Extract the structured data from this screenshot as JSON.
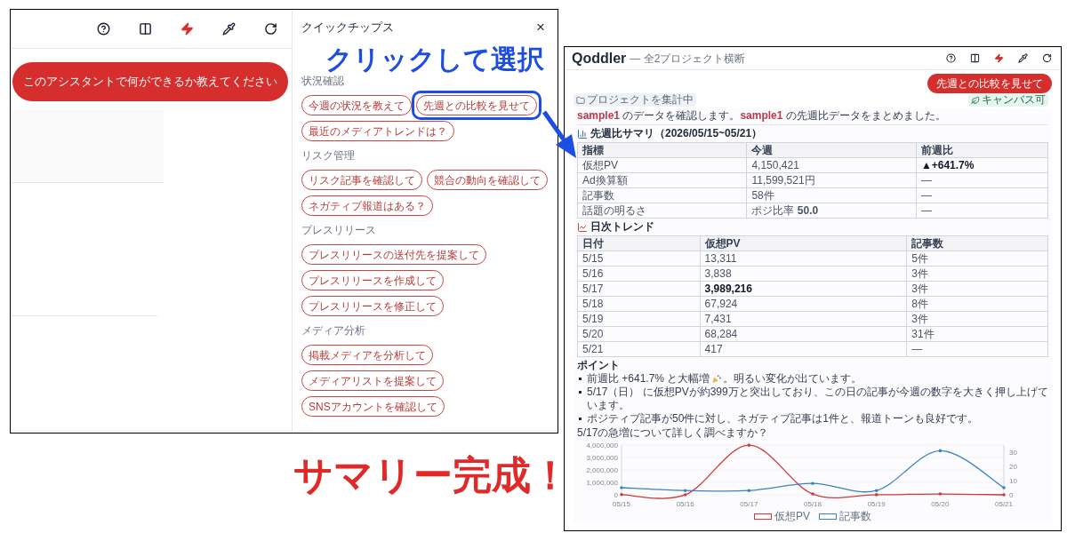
{
  "left_window": {
    "user_message": "このアシスタントで何ができるか教えてください",
    "quick_tips": {
      "title": "クイックチップス",
      "close": "×",
      "sections": [
        {
          "heading": "状況確認",
          "chips": [
            {
              "label": "今週の状況を教えて",
              "highlighted": false
            },
            {
              "label": "先週との比較を見せて",
              "highlighted": true
            },
            {
              "label": "最近のメディアトレンドは？",
              "highlighted": false
            }
          ]
        },
        {
          "heading": "リスク管理",
          "chips": [
            {
              "label": "リスク記事を確認して",
              "highlighted": false
            },
            {
              "label": "競合の動向を確認して",
              "highlighted": false
            },
            {
              "label": "ネガティブ報道はある？",
              "highlighted": false
            }
          ]
        },
        {
          "heading": "プレスリリース",
          "chips": [
            {
              "label": "プレスリリースの送付先を提案して",
              "highlighted": false
            },
            {
              "label": "プレスリリースを作成して",
              "highlighted": false
            },
            {
              "label": "プレスリリースを修正して",
              "highlighted": false
            }
          ]
        },
        {
          "heading": "メディア分析",
          "chips": [
            {
              "label": "掲載メディアを分析して",
              "highlighted": false
            },
            {
              "label": "メディアリストを提案して",
              "highlighted": false
            },
            {
              "label": "SNSアカウントを確認して",
              "highlighted": false
            }
          ]
        }
      ]
    }
  },
  "right_window": {
    "logo": "Qoddler",
    "subtitle": "— 全2プロジェクト横断",
    "user_message": "先週との比較を見せて",
    "status_tag": "プロジェクトを集計中",
    "canvas_badge": "キャンバス可",
    "reply": [
      {
        "kind": "project",
        "text": "sample1"
      },
      {
        "kind": "plain",
        "text": " のデータを確認します。"
      },
      {
        "kind": "project",
        "text": "sample1"
      },
      {
        "kind": "plain",
        "text": " の先週比データをまとめました。"
      }
    ],
    "summary": {
      "title": "先週比サマリ（2026/05/15~05/21）",
      "columns": [
        "指標",
        "今週",
        "前週比"
      ],
      "rows": [
        {
          "cells": [
            "仮想PV",
            "4,150,421",
            "▲+641.7%"
          ],
          "bold": [
            false,
            false,
            true
          ]
        },
        {
          "cells": [
            "Ad換算額",
            "11,599,521円",
            "—"
          ],
          "bold": [
            false,
            false,
            false
          ]
        },
        {
          "cells": [
            "記事数",
            "58件",
            "—"
          ],
          "bold": [
            false,
            false,
            false
          ]
        },
        {
          "cells": [
            "話題の明るさ",
            "ポジ比率 **50.0**",
            "—"
          ],
          "bold": [
            false,
            false,
            false
          ]
        }
      ]
    },
    "trend": {
      "title": "日次トレンド",
      "columns": [
        "日付",
        "仮想PV",
        "記事数"
      ],
      "rows": [
        {
          "cells": [
            "5/15",
            "13,311",
            "5件"
          ],
          "bold": [
            false,
            false,
            false
          ]
        },
        {
          "cells": [
            "5/16",
            "3,838",
            "3件"
          ],
          "bold": [
            false,
            false,
            false
          ]
        },
        {
          "cells": [
            "5/17",
            "3,989,216",
            "3件"
          ],
          "bold": [
            false,
            true,
            false
          ]
        },
        {
          "cells": [
            "5/18",
            "67,924",
            "8件"
          ],
          "bold": [
            false,
            false,
            false
          ]
        },
        {
          "cells": [
            "5/19",
            "7,431",
            "3件"
          ],
          "bold": [
            false,
            false,
            false
          ]
        },
        {
          "cells": [
            "5/20",
            "68,284",
            "31件"
          ],
          "bold": [
            false,
            false,
            false
          ]
        },
        {
          "cells": [
            "5/21",
            "417",
            "—"
          ],
          "bold": [
            false,
            false,
            false
          ]
        }
      ]
    },
    "points": {
      "title": "ポイント",
      "items": [
        {
          "before": "前週比 +641.7% と大幅増",
          "after": "。明るい変化が出ています。"
        },
        {
          "before": "5/17（日） に仮想PVが約399万と突出しており、この日の記事が今週の数字を大きく押し上げています。"
        },
        {
          "before": "ポジティブ記事が50件に対し、ネガティブ記事は1件と、報道トーンも良好です。"
        }
      ]
    },
    "question": "5/17の急増について詳しく調べますか？",
    "chart_data": {
      "type": "line",
      "x": [
        "05/15",
        "05/16",
        "05/17",
        "05/18",
        "05/19",
        "05/20",
        "05/21"
      ],
      "series": [
        {
          "name": "仮想PV",
          "color": "#d03a3a",
          "values": [
            13311,
            3838,
            3989216,
            67924,
            7431,
            68284,
            417
          ]
        },
        {
          "name": "記事数",
          "color": "#3b82c4",
          "axis": "y2",
          "values": [
            5,
            3,
            3,
            8,
            3,
            31,
            5
          ]
        }
      ],
      "ylim": [
        0,
        4000000
      ],
      "yticks": [
        {
          "value": 0,
          "label": "0"
        },
        {
          "value": 1000000,
          "label": "1,000,000"
        },
        {
          "value": 2000000,
          "label": "2,000,000"
        },
        {
          "value": 3000000,
          "label": "3,000,000"
        },
        {
          "value": 4000000,
          "label": "4,000,000"
        }
      ],
      "y2lim": [
        0,
        35
      ],
      "y2ticks": [
        0,
        10,
        20,
        30
      ],
      "legend": "bottom"
    }
  },
  "annotations": {
    "callout": "クリックして選択",
    "result": "サマリー完成！"
  }
}
